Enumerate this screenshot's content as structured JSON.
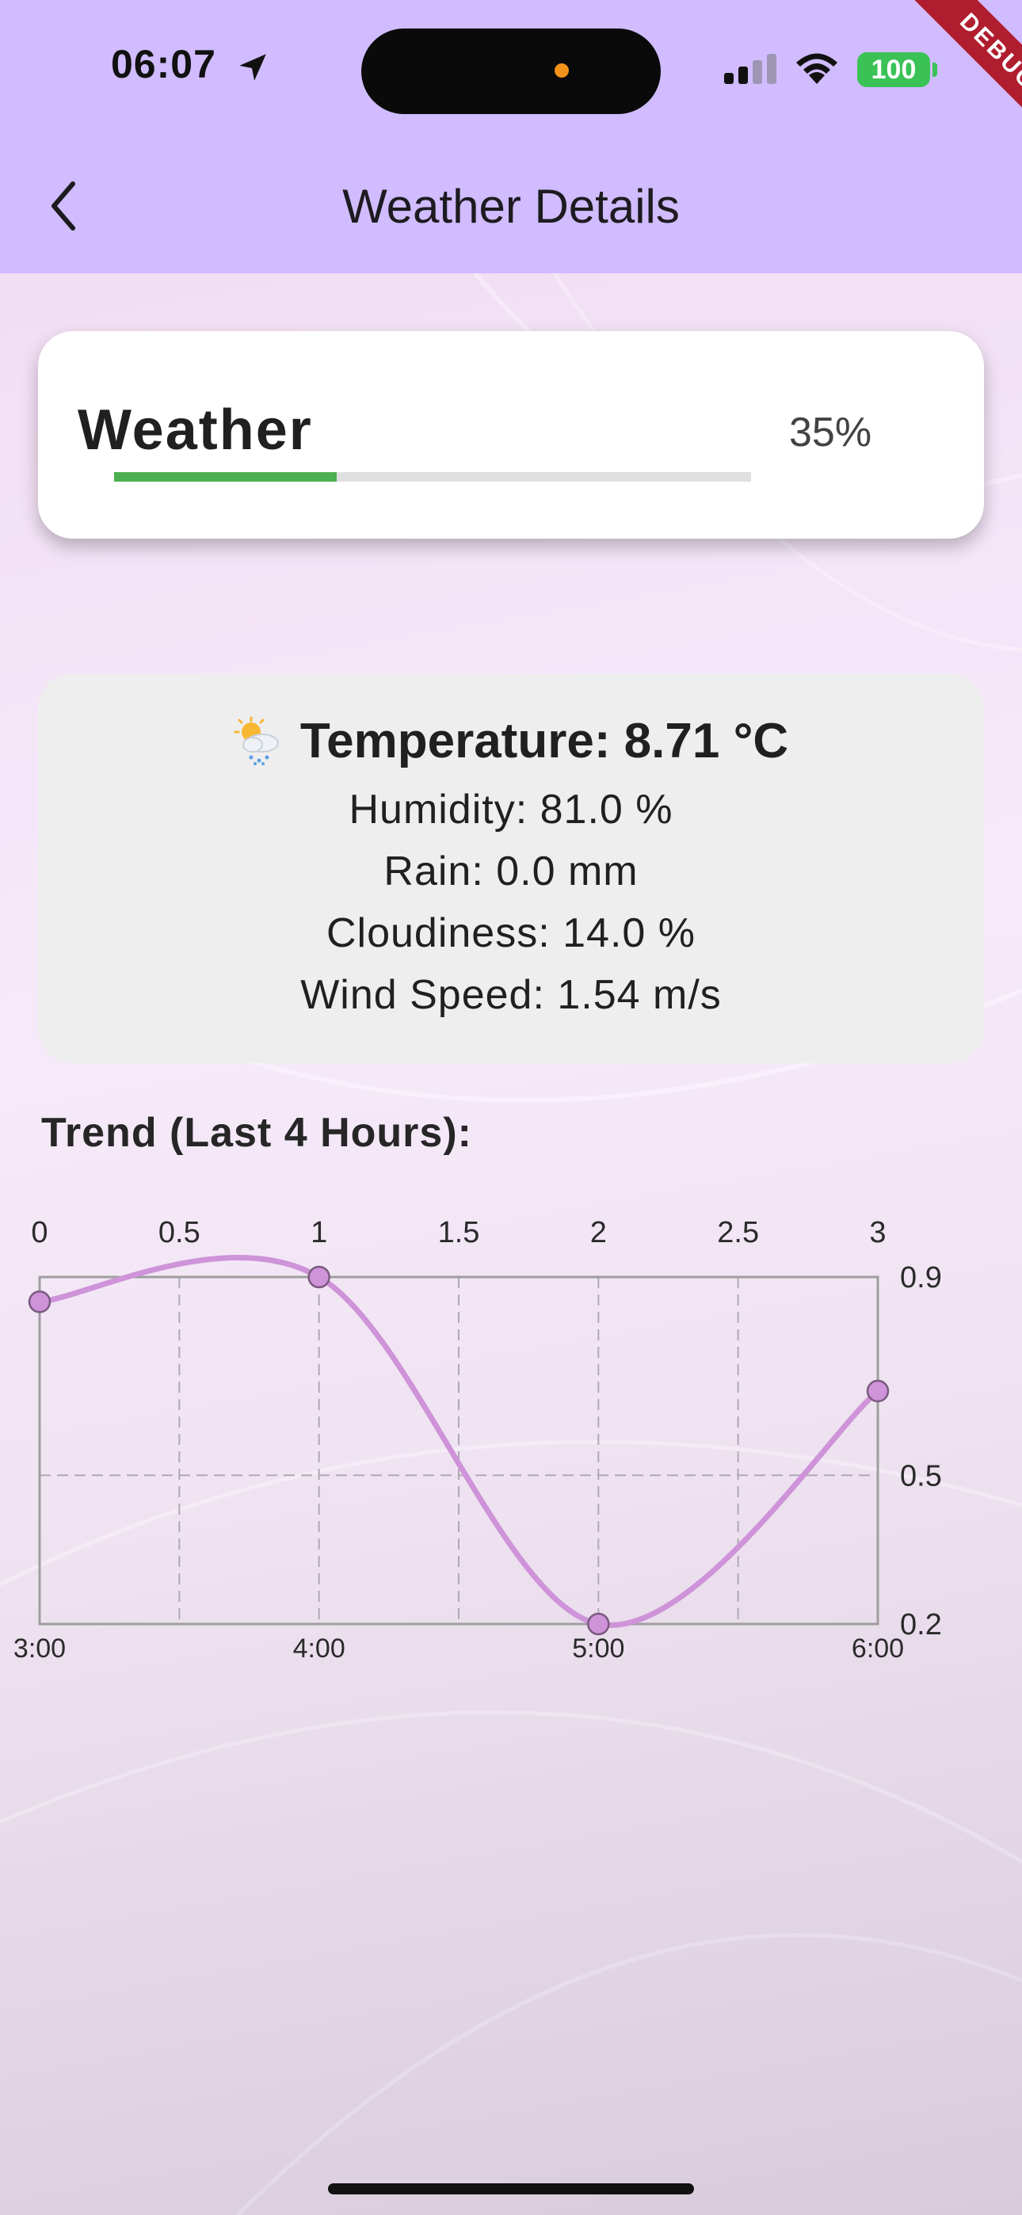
{
  "status_bar": {
    "time": "06:07",
    "battery": "100",
    "icons": [
      "location-arrow-icon",
      "cellular-signal-icon",
      "wifi-icon",
      "battery-icon"
    ]
  },
  "debug_banner": "DEBUG",
  "app_bar": {
    "title": "Weather Details",
    "back_icon": "chevron-left-icon",
    "background": "#d0bcfe"
  },
  "progress_card": {
    "title": "Weather",
    "percent_label": "35%",
    "progress": 0.35,
    "fill_color": "#4caf50",
    "track_color": "#e0e0e0"
  },
  "weather_card": {
    "icon": "sun-cloud-rain-icon",
    "temperature": "Temperature: 8.71 °C",
    "humidity": "Humidity: 81.0 %",
    "rain": "Rain: 0.0 mm",
    "cloudiness": "Cloudiness: 14.0 %",
    "wind_speed": "Wind Speed: 1.54 m/s"
  },
  "trend": {
    "title": "Trend (Last 4 Hours):"
  },
  "chart_data": {
    "type": "line",
    "x": [
      0,
      1,
      2,
      3
    ],
    "values": [
      0.85,
      0.9,
      0.2,
      0.67
    ],
    "xlim": [
      0,
      3
    ],
    "ylim": [
      0.2,
      0.9
    ],
    "top_ticks": [
      "0",
      "0.5",
      "1",
      "1.5",
      "2",
      "2.5",
      "3"
    ],
    "top_tick_values": [
      0,
      0.5,
      1,
      1.5,
      2,
      2.5,
      3
    ],
    "bottom_ticks": [
      "3:00",
      "4:00",
      "5:00",
      "6:00"
    ],
    "bottom_tick_values": [
      0,
      1,
      2,
      3
    ],
    "right_ticks": [
      "0.9",
      "0.5",
      "0.2"
    ],
    "right_tick_values": [
      0.9,
      0.5,
      0.2
    ],
    "grid": true,
    "grid_style": "dashed",
    "curve": "smooth",
    "line_color": "#ce93d8"
  }
}
